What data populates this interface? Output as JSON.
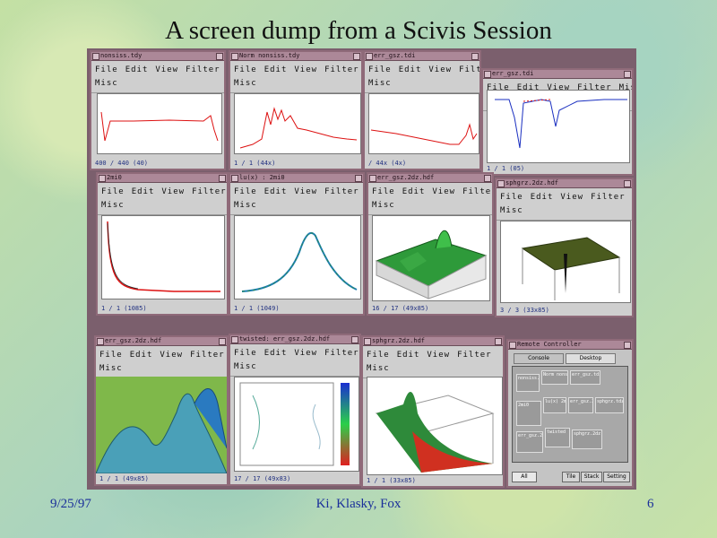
{
  "slide": {
    "title": "A screen dump from a Scivis Session",
    "footer_date": "9/25/97",
    "footer_authors": "Ki, Klasky, Fox",
    "footer_page": "6"
  },
  "menu": {
    "file": "File",
    "edit": "Edit",
    "view": "View",
    "filter": "Filter",
    "misc": "Misc"
  },
  "windows": {
    "w1": {
      "title": "nonsiss.tdy",
      "status": "400 / 440  (40)"
    },
    "w2": {
      "title": "Norm  nonsiss.tdy",
      "status": "1 / 1  (44x)"
    },
    "w3": {
      "title": "err_gsz.tdi",
      "status": "/ 44x  (4x)"
    },
    "w4": {
      "title": "err_gsz.tdi",
      "status": "1 / 1  (05)"
    },
    "w5": {
      "title": "2mi0",
      "status": "1 / 1  (1085)"
    },
    "w6": {
      "title": "lu(x) : 2mi0",
      "status": "1 / 1  (1049)"
    },
    "w7": {
      "title": "err_gsz.2dz.hdf",
      "status": "16 / 17  (49x85)"
    },
    "w8": {
      "title": "sphgrz.2dz.hdf",
      "status": "3 / 3  (33x85)"
    },
    "w9": {
      "title": "err_gsz.2dz.hdf",
      "status": "1 / 1  (49x85)"
    },
    "w10": {
      "title": "twisted:  err_gsz.2dz.hdf",
      "status": "17 / 17  (49x83)"
    },
    "w11": {
      "title": "sphgrz.2dz.hdf",
      "status": "1 / 1  (33x85)"
    }
  },
  "remote": {
    "title": "Remote Controller",
    "tab_console": "Console",
    "tab_desktop": "Desktop",
    "cards": [
      "nonsiss.1",
      "Norm  nonsiss",
      "err_gsz.tdi",
      "2mi0",
      "lu(x) 2mi0",
      "err_gsz.2dz",
      "sphgrz.tdz",
      "err_gsz.2d",
      "twisted",
      "sphgrz.2dz"
    ],
    "btn_all": "All",
    "btn_tile": "Tile",
    "btn_stack": "Stack",
    "btn_setting": "Setting"
  }
}
